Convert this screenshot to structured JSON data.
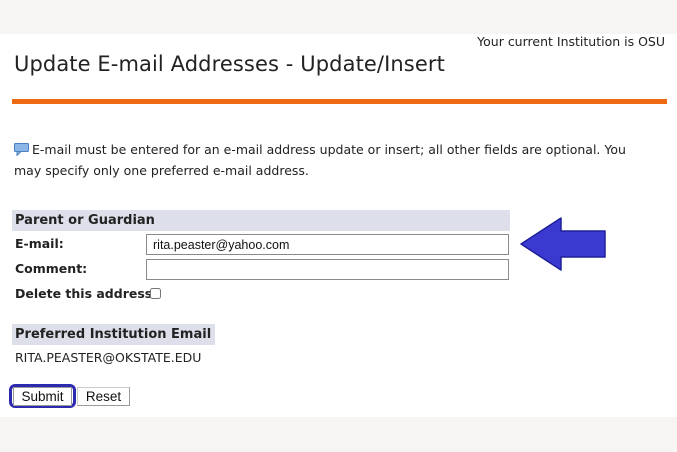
{
  "header": {
    "institution_text": "Your current Institution is OSU",
    "page_title": "Update E-mail Addresses - Update/Insert"
  },
  "info_message": "E-mail must be entered for an e-mail address update or insert; all other fields are optional. You may specify only one preferred e-mail address.",
  "form": {
    "section_title": "Parent or Guardian",
    "email_label": "E-mail:",
    "email_value": "rita.peaster@yahoo.com",
    "comment_label": "Comment:",
    "comment_value": "",
    "delete_label": "Delete this address:",
    "delete_checked": false
  },
  "preferred": {
    "section_title": "Preferred Institution Email",
    "value": "RITA.PEASTER@OKSTATE.EDU"
  },
  "buttons": {
    "submit_label": "Submit",
    "reset_label": "Reset"
  },
  "colors": {
    "accent_rule": "#ee6a12",
    "section_bg": "#dde0ea",
    "annotation_blue": "#3a3ad0"
  },
  "icons": {
    "info": "comment-info-icon",
    "pointer": "arrow-left-icon"
  }
}
